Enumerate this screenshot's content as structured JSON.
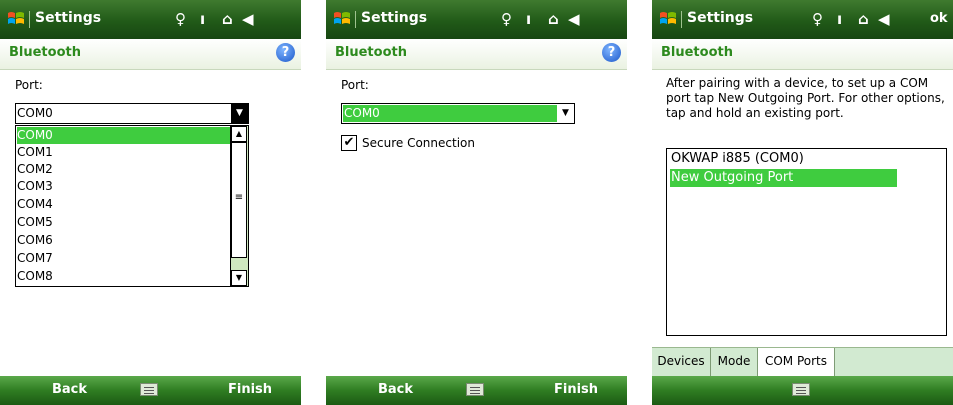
{
  "screens": [
    {
      "title": "Settings",
      "header": "Bluetooth",
      "port_label": "Port:",
      "combo_value": "COM0",
      "dropdown_items": [
        "COM0",
        "COM1",
        "COM2",
        "COM3",
        "COM4",
        "COM5",
        "COM6",
        "COM7",
        "COM8"
      ],
      "selected_item": "COM0",
      "softkeys": {
        "left": "Back",
        "right": "Finish"
      }
    },
    {
      "title": "Settings",
      "header": "Bluetooth",
      "port_label": "Port:",
      "combo_value": "COM0",
      "checkbox_label": "Secure Connection",
      "checkbox_checked": true,
      "softkeys": {
        "left": "Back",
        "right": "Finish"
      }
    },
    {
      "title": "Settings",
      "ok_label": "ok",
      "header": "Bluetooth",
      "description": "After pairing with a device, to set up a COM port tap New Outgoing Port. For other options, tap and hold an existing port.",
      "list_items": [
        "OKWAP i885 (COM0)",
        "New Outgoing Port"
      ],
      "selected_item": "New Outgoing Port",
      "tabs": [
        "Devices",
        "Mode",
        "COM Ports"
      ],
      "active_tab": "COM Ports"
    }
  ],
  "icons": {
    "start": "windows-flag-icon",
    "connectivity": "antenna-icon",
    "signal": "signal-icon",
    "battery": "no-battery-icon",
    "volume": "speaker-icon",
    "help": "help-icon",
    "keyboard": "keyboard-icon"
  },
  "colors": {
    "titlebar": "#215a18",
    "header_text": "#2d8a1e",
    "selection": "#3fcc3f",
    "tab_bar": "#d2ead1"
  }
}
